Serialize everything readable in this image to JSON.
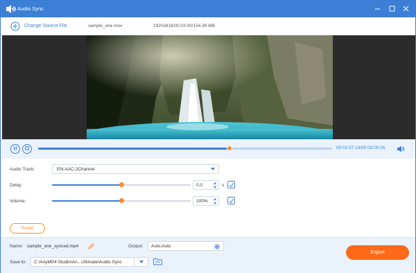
{
  "window": {
    "title": "Audio Sync"
  },
  "source": {
    "change_label": "Change Source File",
    "file_name": "sample_one.mov",
    "file_info": "1920x816/00:03:00/154.36 MB"
  },
  "playback": {
    "time": "00:01:57.14/00:03:00.05",
    "progress": 0.65
  },
  "settings": {
    "audio_track_label": "Audio Track:",
    "audio_track_value": "EN-AAC-2Channel",
    "delay_label": "Delay:",
    "delay_value": "0.0",
    "delay_unit": "s",
    "delay_level": 0.5,
    "volume_label": "Volume:",
    "volume_value": "100%",
    "volume_level": 0.5,
    "reset_label": "Reset"
  },
  "output": {
    "name_label": "Name:",
    "name_value": "sample_one_synced.mp4",
    "output_label": "Output:",
    "output_value": "Auto;Auto",
    "save_label": "Save to:",
    "save_path": "C:\\AnyMP4 Studio\\An...Ultimate\\Audio Sync",
    "export_label": "Export"
  },
  "colors": {
    "accent": "#3b7fd6",
    "orange": "#ff6a1a",
    "thumb": "#ff8a2a"
  },
  "icons": [
    "audio-sync-app-icon",
    "minimize-icon",
    "maximize-icon",
    "close-icon",
    "add-icon",
    "pause-icon",
    "stop-icon",
    "volume-icon",
    "sync-icon",
    "edit-icon",
    "gear-icon",
    "folder-icon",
    "chevron-down-icon"
  ]
}
